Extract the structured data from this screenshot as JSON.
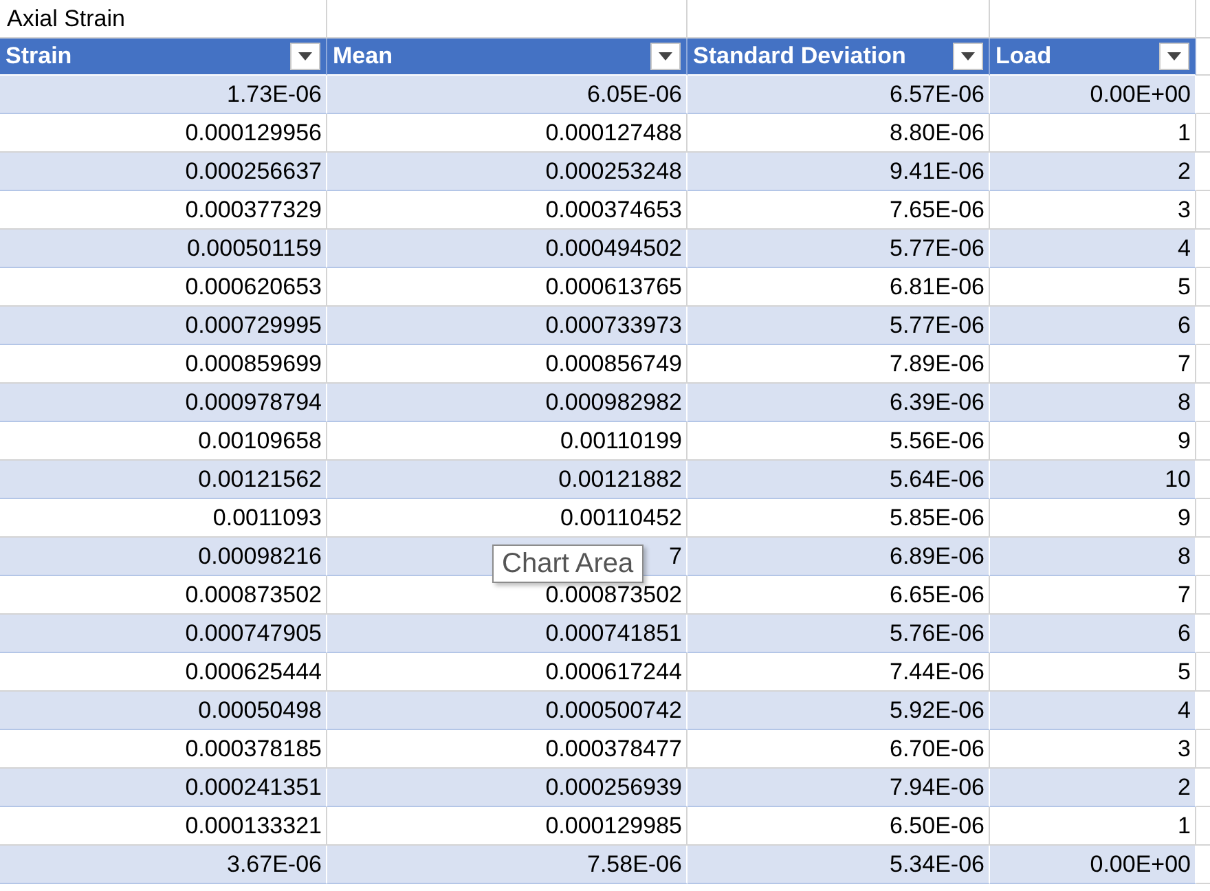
{
  "title": "Axial Strain",
  "table": {
    "columns": [
      "Strain",
      "Mean",
      "Standard Deviation",
      "Load"
    ],
    "rows": [
      [
        "1.73E-06",
        "6.05E-06",
        "6.57E-06",
        "0.00E+00"
      ],
      [
        "0.000129956",
        "0.000127488",
        "8.80E-06",
        "1"
      ],
      [
        "0.000256637",
        "0.000253248",
        "9.41E-06",
        "2"
      ],
      [
        "0.000377329",
        "0.000374653",
        "7.65E-06",
        "3"
      ],
      [
        "0.000501159",
        "0.000494502",
        "5.77E-06",
        "4"
      ],
      [
        "0.000620653",
        "0.000613765",
        "6.81E-06",
        "5"
      ],
      [
        "0.000729995",
        "0.000733973",
        "5.77E-06",
        "6"
      ],
      [
        "0.000859699",
        "0.000856749",
        "7.89E-06",
        "7"
      ],
      [
        "0.000978794",
        "0.000982982",
        "6.39E-06",
        "8"
      ],
      [
        "0.00109658",
        "0.00110199",
        "5.56E-06",
        "9"
      ],
      [
        "0.00121562",
        "0.00121882",
        "5.64E-06",
        "10"
      ],
      [
        "0.0011093",
        "0.00110452",
        "5.85E-06",
        "9"
      ],
      [
        "0.00098216",
        "7",
        "6.89E-06",
        "8"
      ],
      [
        "0.000873502",
        "0.000873502",
        "6.65E-06",
        "7"
      ],
      [
        "0.000747905",
        "0.000741851",
        "5.76E-06",
        "6"
      ],
      [
        "0.000625444",
        "0.000617244",
        "7.44E-06",
        "5"
      ],
      [
        "0.00050498",
        "0.000500742",
        "5.92E-06",
        "4"
      ],
      [
        "0.000378185",
        "0.000378477",
        "6.70E-06",
        "3"
      ],
      [
        "0.000241351",
        "0.000256939",
        "7.94E-06",
        "2"
      ],
      [
        "0.000133321",
        "0.000129985",
        "6.50E-06",
        "1"
      ],
      [
        "3.67E-06",
        "7.58E-06",
        "5.34E-06",
        "0.00E+00"
      ]
    ]
  },
  "tooltip": "Chart Area"
}
